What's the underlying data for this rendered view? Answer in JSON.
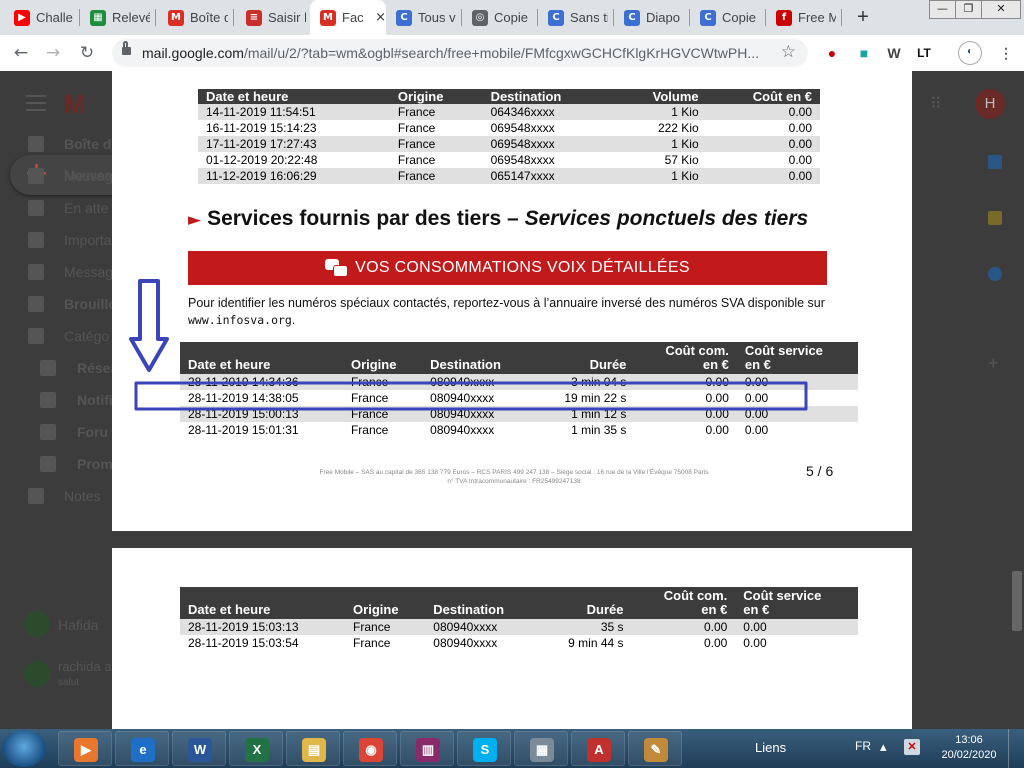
{
  "browser": {
    "tabs": [
      {
        "label": "Challe",
        "icon": "youtube-icon",
        "color": "#ff0000"
      },
      {
        "label": "Relevé",
        "icon": "spreadsheet-icon",
        "color": "#1e8e3e"
      },
      {
        "label": "Boîte d",
        "icon": "gmail-icon",
        "color": "#d93025"
      },
      {
        "label": "Saisir l",
        "icon": "flag-icon",
        "color": "#c9302c"
      },
      {
        "label": "Fac",
        "icon": "gmail-icon",
        "color": "#d93025",
        "active": true
      },
      {
        "label": "Tous v",
        "icon": "copy-icon",
        "color": "#3b6fd1"
      },
      {
        "label": "Copie",
        "icon": "globe-icon",
        "color": "#5f6368"
      },
      {
        "label": "Sans ti",
        "icon": "copy-icon",
        "color": "#3b6fd1"
      },
      {
        "label": "Diapo",
        "icon": "copy-icon",
        "color": "#3b6fd1"
      },
      {
        "label": "Copie",
        "icon": "copy-icon",
        "color": "#3b6fd1"
      },
      {
        "label": "Free M",
        "icon": "free-icon",
        "color": "#cc0000"
      }
    ],
    "url_host": "mail.google.com",
    "url_path": "/mail/u/2/?tab=wm&ogbl#search/free+mobile/FMfcgxwGCHCfKlgKrHGVCWtwPH..."
  },
  "gmail": {
    "compose_label": "Nouveau",
    "nav": [
      "Boîte de",
      "Messag",
      "En atte",
      "Importa",
      "Messag",
      "Brouillo",
      "Catégo",
      "Résea",
      "Notifi",
      "Foru",
      "Promo",
      "Notes"
    ],
    "user": "Hafida",
    "chat_name": "rachida a",
    "chat_status": "salut"
  },
  "invoice": {
    "table1": {
      "headers": [
        "Date et heure",
        "Origine",
        "Destination",
        "Volume",
        "Coût en €"
      ],
      "rows": [
        [
          "14-11-2019 11:54:51",
          "France",
          "064346xxxx",
          "1 Kio",
          "0.00"
        ],
        [
          "16-11-2019 15:14:23",
          "France",
          "069548xxxx",
          "222 Kio",
          "0.00"
        ],
        [
          "17-11-2019 17:27:43",
          "France",
          "069548xxxx",
          "1 Kio",
          "0.00"
        ],
        [
          "01-12-2019 20:22:48",
          "France",
          "069548xxxx",
          "57 Kio",
          "0.00"
        ],
        [
          "11-12-2019 16:06:29",
          "France",
          "065147xxxx",
          "1 Kio",
          "0.00"
        ]
      ]
    },
    "section_title": "Services fournis par des tiers –",
    "section_title_italic": "Services ponctuels des tiers",
    "banner": "VOS CONSOMMATIONS VOIX DÉTAILLÉES",
    "intro_text": "Pour identifier les numéros spéciaux contactés, reportez-vous à l’annuaire inversé des numéros SVA disponible sur",
    "intro_site": "www.infosva.org",
    "voice_headers": [
      "Date et heure",
      "Origine",
      "Destination",
      "Durée",
      "Coût com.",
      "en €",
      "Coût service",
      "en €"
    ],
    "table2_rows": [
      [
        "28-11-2019 14:34:36",
        "France",
        "080940xxxx",
        "3 min 04 s",
        "0.00",
        "0.00"
      ],
      [
        "28-11-2019 14:38:05",
        "France",
        "080940xxxx",
        "19 min 22 s",
        "0.00",
        "0.00"
      ],
      [
        "28-11-2019 15:00:13",
        "France",
        "080940xxxx",
        "1 min 12 s",
        "0.00",
        "0.00"
      ],
      [
        "28-11-2019 15:01:31",
        "France",
        "080940xxxx",
        "1 min 35 s",
        "0.00",
        "0.00"
      ]
    ],
    "footer_line1": "Free Mobile – SAS au capital de 365 138 779 Euros – RCS PARIS 499 247 138 – Siège social : 16 rue de la Ville l’Évêque 75008 Paris",
    "footer_line2": "n° TVA Intracommunautaire : FR25499247138",
    "page_number": "5 / 6",
    "table3_rows": [
      [
        "28-11-2019 15:03:13",
        "France",
        "080940xxxx",
        "35 s",
        "0.00",
        "0.00"
      ],
      [
        "28-11-2019 15:03:54",
        "France",
        "080940xxxx",
        "9 min 44 s",
        "0.00",
        "0.00"
      ]
    ]
  },
  "annotation": {
    "color": "#3c45b8"
  },
  "taskbar": {
    "links_label": "Liens",
    "language": "FR",
    "time": "13:06",
    "date": "20/02/2020",
    "apps": [
      "media-player-icon",
      "internet-explorer-icon",
      "word-icon",
      "excel-icon",
      "file-explorer-icon",
      "chrome-icon",
      "winrar-icon",
      "skype-icon",
      "calculator-icon",
      "pdf-icon",
      "paint-icon"
    ]
  }
}
